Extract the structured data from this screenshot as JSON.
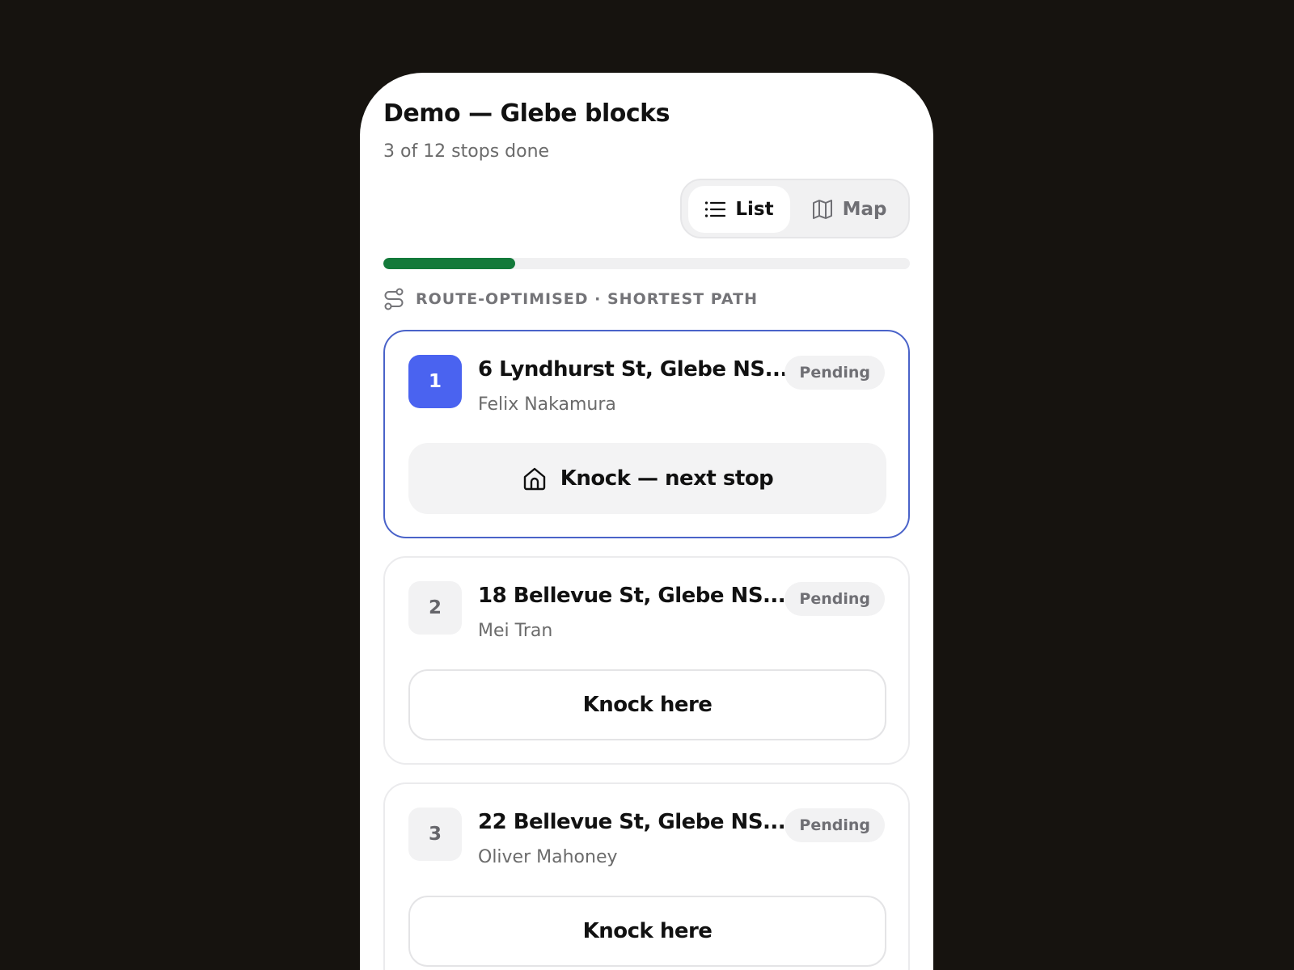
{
  "header": {
    "title": "Demo — Glebe blocks",
    "subtitle": "3 of 12 stops done"
  },
  "view_toggle": {
    "list_label": "List",
    "map_label": "Map",
    "selected": "List"
  },
  "progress": {
    "done": 3,
    "total": 12,
    "fraction": 0.25,
    "color": "#137a3a"
  },
  "route_label": "ROUTE-OPTIMISED · SHORTEST PATH",
  "stops": [
    {
      "number": "1",
      "address": "6 Lyndhurst St, Glebe NS...",
      "person": "Felix Nakamura",
      "status": "Pending",
      "action": "Knock — next stop",
      "active": true
    },
    {
      "number": "2",
      "address": "18 Bellevue St, Glebe NS...",
      "person": "Mei Tran",
      "status": "Pending",
      "action": "Knock here",
      "active": false
    },
    {
      "number": "3",
      "address": "22 Bellevue St, Glebe NS...",
      "person": "Oliver Mahoney",
      "status": "Pending",
      "action": "Knock here",
      "active": false
    }
  ],
  "colors": {
    "accent": "#4a63f0",
    "active_border": "#4a63c9",
    "background": "#16130f"
  },
  "icons": {
    "list": "list-icon",
    "map": "map-icon",
    "route": "route-icon",
    "home": "home-icon"
  }
}
